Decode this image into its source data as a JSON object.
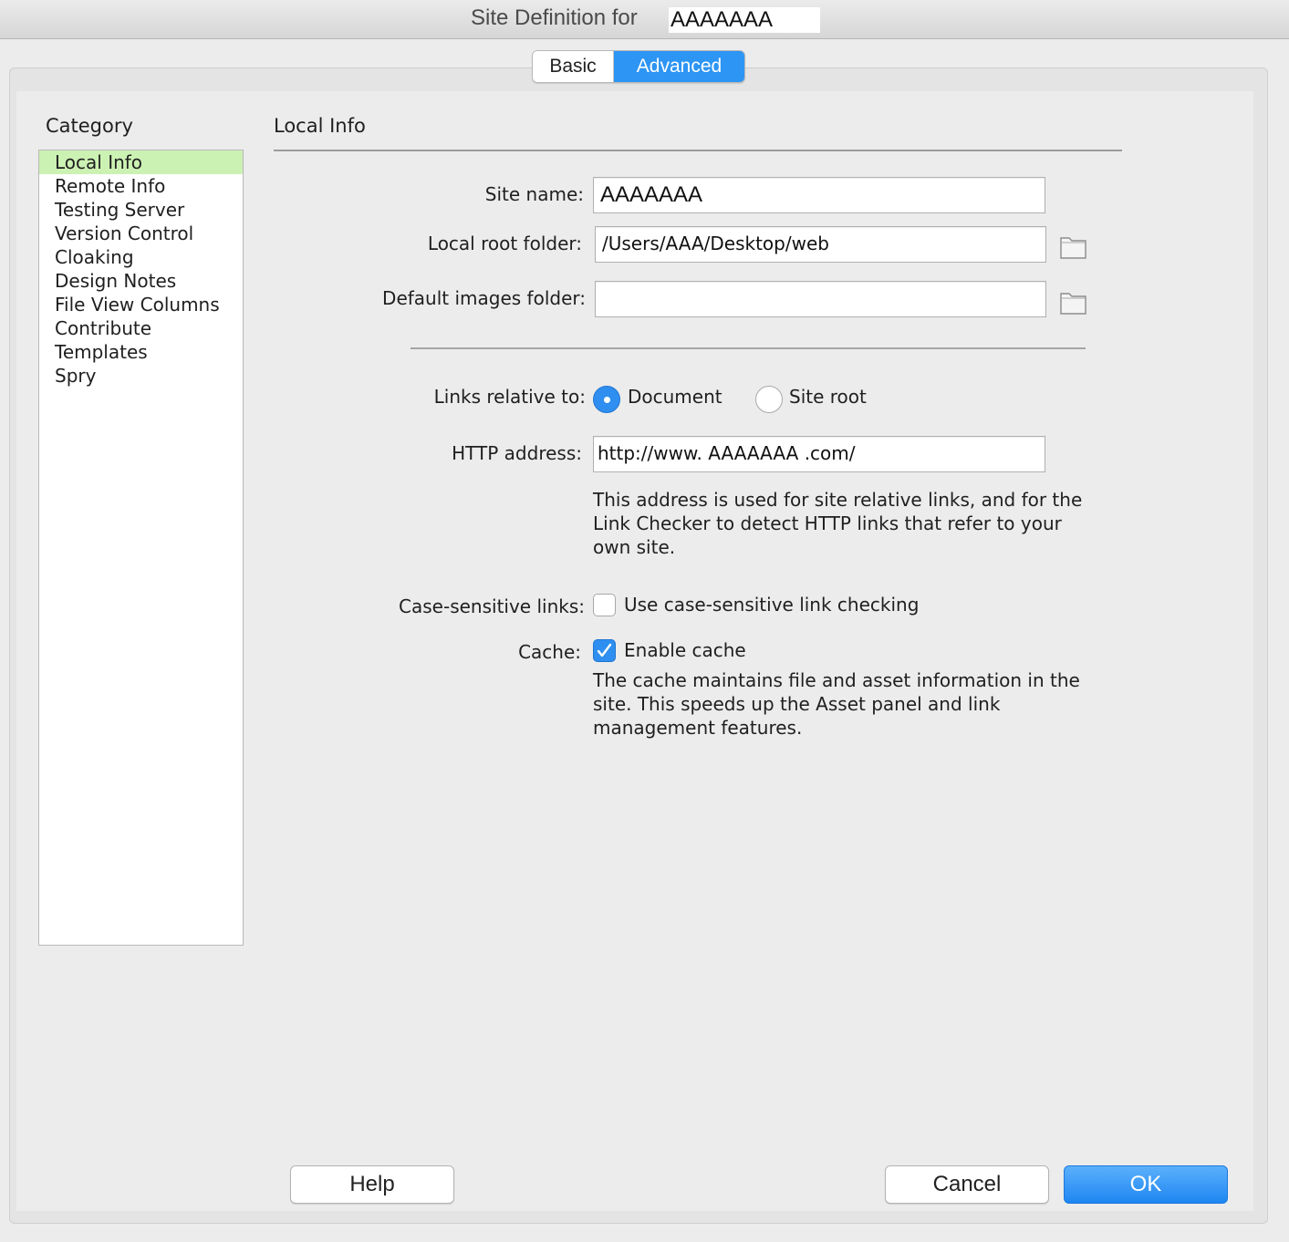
{
  "window": {
    "title_prefix": "Site Definition for",
    "title_name": "AAAAAAA"
  },
  "tabs": [
    {
      "label": "Basic",
      "selected": false
    },
    {
      "label": "Advanced",
      "selected": true
    }
  ],
  "category": {
    "label": "Category",
    "items": [
      {
        "label": "Local Info",
        "selected": true
      },
      {
        "label": "Remote Info"
      },
      {
        "label": "Testing Server"
      },
      {
        "label": "Version Control"
      },
      {
        "label": "Cloaking"
      },
      {
        "label": "Design Notes"
      },
      {
        "label": "File View Columns"
      },
      {
        "label": "Contribute"
      },
      {
        "label": "Templates"
      },
      {
        "label": "Spry"
      }
    ]
  },
  "section": {
    "title": "Local Info"
  },
  "form": {
    "site_name_label": "Site name:",
    "site_name_value": "AAAAAAA",
    "local_root_label": "Local root folder:",
    "local_root_value": "/Users/AAA/Desktop/web",
    "default_images_label": "Default images folder:",
    "default_images_value": "",
    "links_relative_label": "Links relative to:",
    "links_option_document": "Document",
    "links_option_site_root": "Site root",
    "links_selected": "Document",
    "http_label": "HTTP address:",
    "http_value": "http://www. AAAAAAA .com/",
    "http_help": "This address is used for site relative links, and for the Link Checker to detect HTTP links that refer to your own site.",
    "case_label": "Case-sensitive links:",
    "case_option": "Use case-sensitive link checking",
    "case_checked": false,
    "cache_label": "Cache:",
    "cache_option": "Enable cache",
    "cache_checked": true,
    "cache_help": "The cache maintains file and asset information in the site.  This speeds up the Asset panel and link management features."
  },
  "buttons": {
    "help": "Help",
    "cancel": "Cancel",
    "ok": "OK"
  },
  "colors": {
    "accent": "#2d95f3",
    "selection_green": "#ccf2b3"
  },
  "icons": {
    "folder": "folder-icon",
    "check": "checkmark-icon"
  }
}
